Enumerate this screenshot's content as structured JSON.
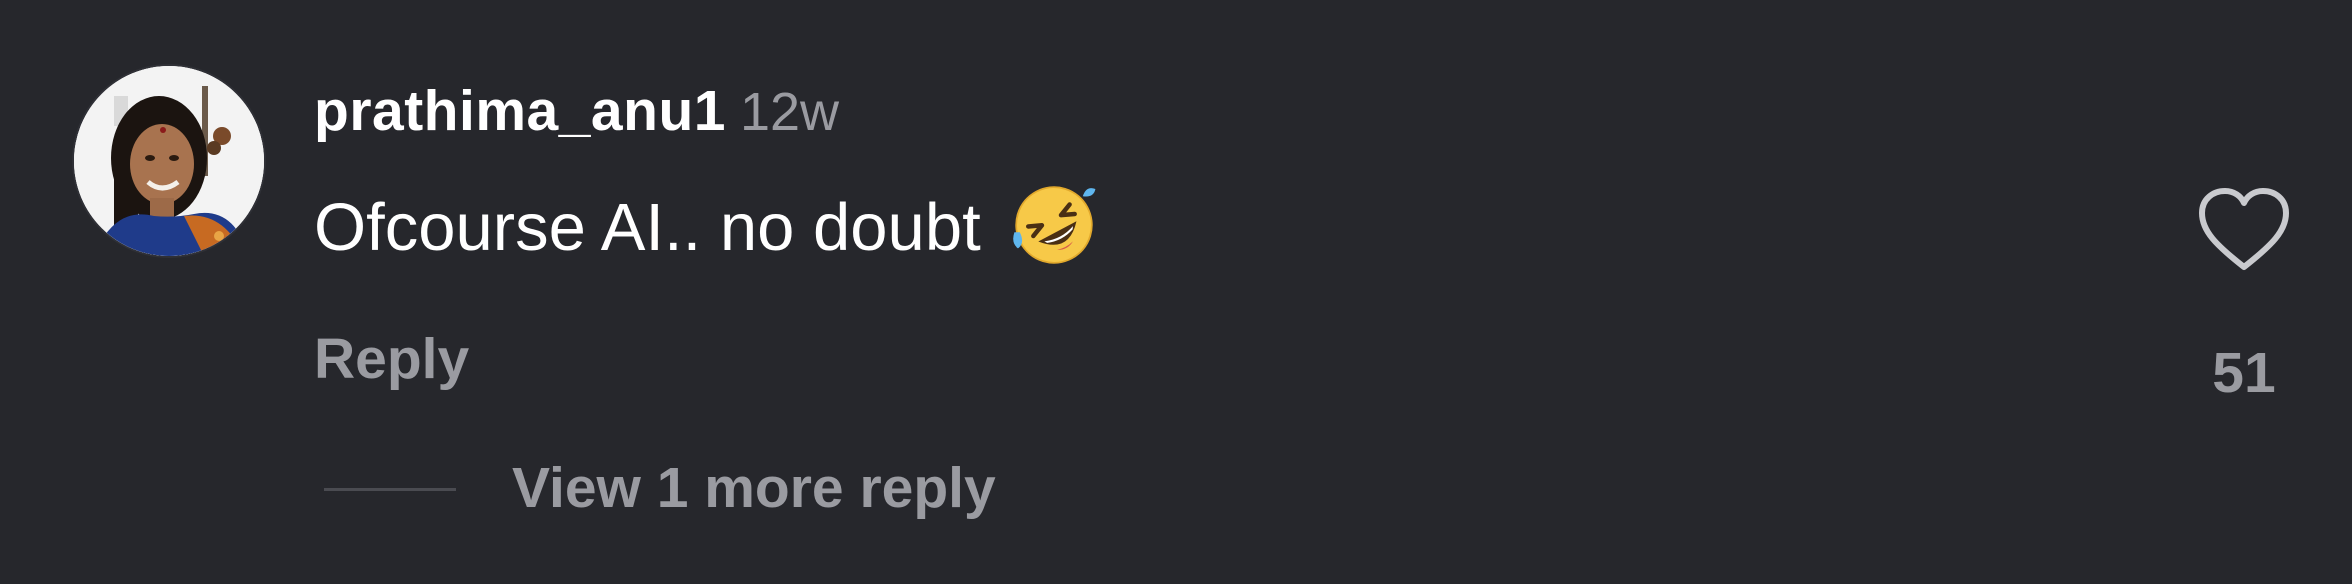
{
  "comment": {
    "username": "prathima_anu1",
    "timestamp": "12w",
    "text": "Ofcourse AI.. no doubt",
    "emoji": "rolling-on-the-floor-laughing-emoji",
    "reply_label": "Reply",
    "view_replies_label": "View 1 more reply",
    "like_count": "51",
    "like_icon": "heart-icon",
    "avatar": "user-avatar-photo"
  },
  "colors": {
    "background": "#26272c",
    "primary_text": "#ffffff",
    "secondary_text": "#9a9ba1",
    "divider": "#4a4b51"
  }
}
